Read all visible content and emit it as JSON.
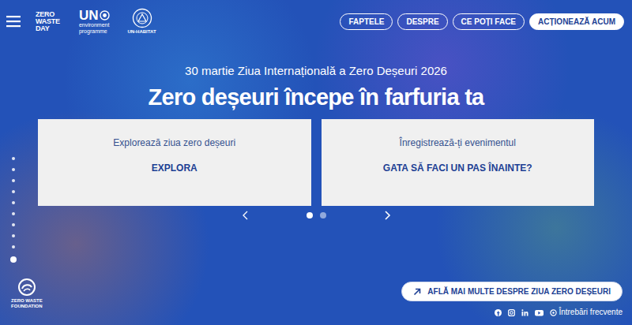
{
  "header": {
    "logo": {
      "lines": [
        "ZERO",
        "WASTE",
        "DAY"
      ]
    },
    "unep": {
      "mark": "UN",
      "lines": [
        "environment",
        "programme"
      ]
    },
    "unhabitat": {
      "label": "UN-HABITAT"
    },
    "nav": [
      {
        "label": "FAPTELE",
        "kind": "outline"
      },
      {
        "label": "DESPRE",
        "kind": "outline"
      },
      {
        "label": "CE POȚI FACE",
        "kind": "outline"
      },
      {
        "label": "ACȚIONEAZĂ ACUM",
        "kind": "primary"
      }
    ]
  },
  "hero": {
    "subtitle": "30 martie Ziua Internațională a Zero Deșeuri 2026",
    "title": "Zero deșeuri începe în farfuria ta"
  },
  "cards": [
    {
      "caption": "Explorează ziua zero deșeuri",
      "action": "EXPLORA"
    },
    {
      "caption": "Înregistrează-ți evenimentul",
      "action": "GATA SĂ FACI UN PAS ÎNAINTE?"
    }
  ],
  "carousel": {
    "dots": [
      {
        "selected": true
      },
      {
        "selected": false
      }
    ]
  },
  "side_nav": [
    {
      "selected": false
    },
    {
      "selected": false
    },
    {
      "selected": false
    },
    {
      "selected": false
    },
    {
      "selected": false
    },
    {
      "selected": false
    },
    {
      "selected": false
    },
    {
      "selected": false
    },
    {
      "selected": false
    },
    {
      "selected": true
    }
  ],
  "footer": {
    "foundation": [
      "ZERO WASTE",
      "FOUNDATION"
    ],
    "cta": "AFLĂ MAI MULTE DESPRE ZIUA ZERO DEȘEURI",
    "faq": "Întrebări frecvente"
  }
}
